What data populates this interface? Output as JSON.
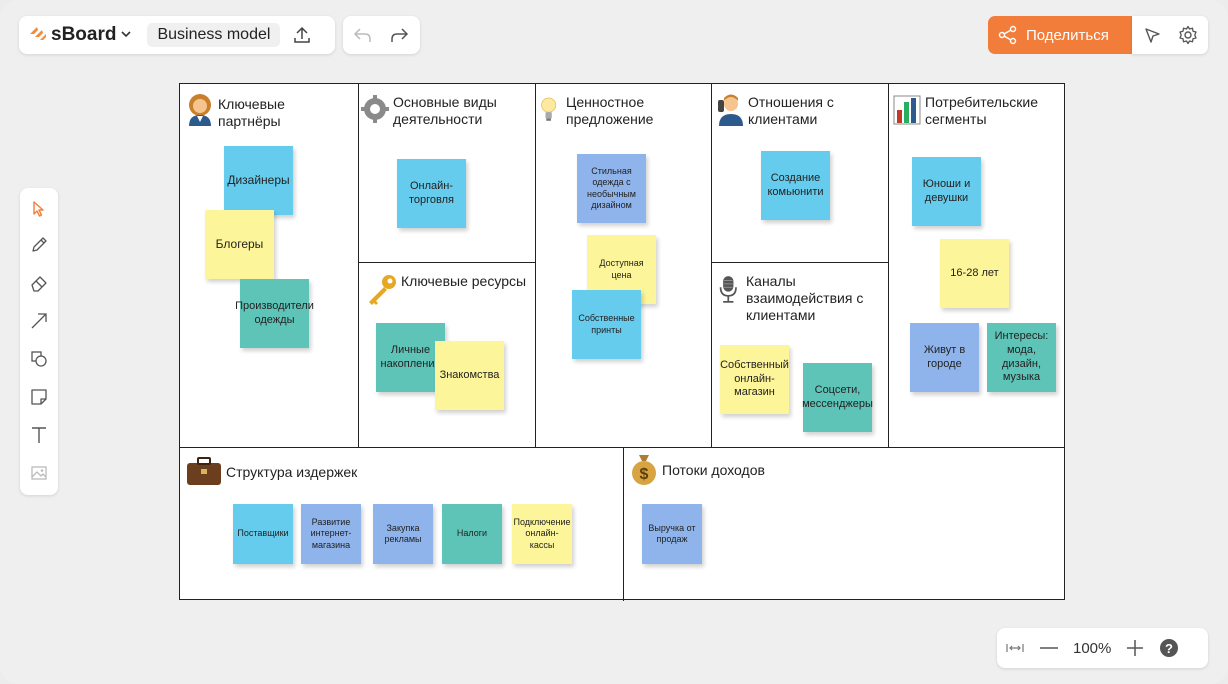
{
  "app": {
    "logo": "sBoard",
    "board_title": "Business model"
  },
  "share": {
    "label": "Поделиться"
  },
  "zoom": {
    "level": "100%"
  },
  "colors": {
    "accent": "#f27d3b",
    "blue": "#66ccee",
    "lightblue": "#8fb4ec",
    "yellow": "#fdf59a",
    "teal": "#5fc4b8"
  },
  "sections": {
    "partners": "Ключевые партнёры",
    "activities": "Основные виды деятельности",
    "value": "Ценностное предложение",
    "relations": "Отношения с клиентами",
    "segments": "Потребительские сегменты",
    "resources": "Ключевые ресурсы",
    "channels": "Каналы взаимодействия с клиентами",
    "costs": "Структура издержек",
    "revenue": "Потоки доходов"
  },
  "notes": {
    "partners": [
      "Дизайнеры",
      "Блогеры",
      "Производители одежды"
    ],
    "activities": [
      "Онлайн-торговля"
    ],
    "resources": [
      "Личные накопления",
      "Знакомства"
    ],
    "value": [
      "Стильная одежда с необычным дизайном",
      "Доступная цена",
      "Собственные принты"
    ],
    "relations": [
      "Создание комьюнити"
    ],
    "channels": [
      "Собственный онлайн-магазин",
      "Соцсети, мессенджеры"
    ],
    "segments": [
      "Юноши и девушки",
      "16-28 лет",
      "Живут в городе",
      "Интересы: мода, дизайн, музыка"
    ],
    "costs": [
      "Поставщики",
      "Развитие интернет-магазина",
      "Закупка рекламы",
      "Налоги",
      "Подключение онлайн-кассы"
    ],
    "revenue": [
      "Выручка от продаж"
    ]
  }
}
